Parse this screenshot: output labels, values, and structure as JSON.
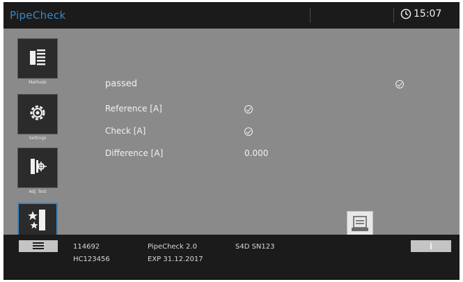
{
  "header": {
    "app_title": "PipeCheck",
    "time": "15:07"
  },
  "sidebar": {
    "items": [
      {
        "label": "Methods",
        "icon": "methods-icon"
      },
      {
        "label": "Settings",
        "icon": "settings-gear-icon"
      },
      {
        "label": "Adj. Test",
        "icon": "adjustment-test-icon"
      },
      {
        "label": "",
        "icon": "favorites-stars-icon"
      }
    ]
  },
  "main": {
    "status": "passed",
    "reference_label": "Reference [A]",
    "check_label": "Check [A]",
    "difference_label": "Difference [A]",
    "difference_value": "0.000"
  },
  "footer": {
    "serial": "114692",
    "model": "PipeCheck 2.0",
    "sensor": "S4D SN123",
    "device_id": "HC123456",
    "expiry": "EXP 31.12.2017",
    "info_label": "i"
  },
  "colors": {
    "accent": "#3b87c6",
    "bar_background": "#1b1b1b",
    "content_background": "#8a8a8a"
  }
}
